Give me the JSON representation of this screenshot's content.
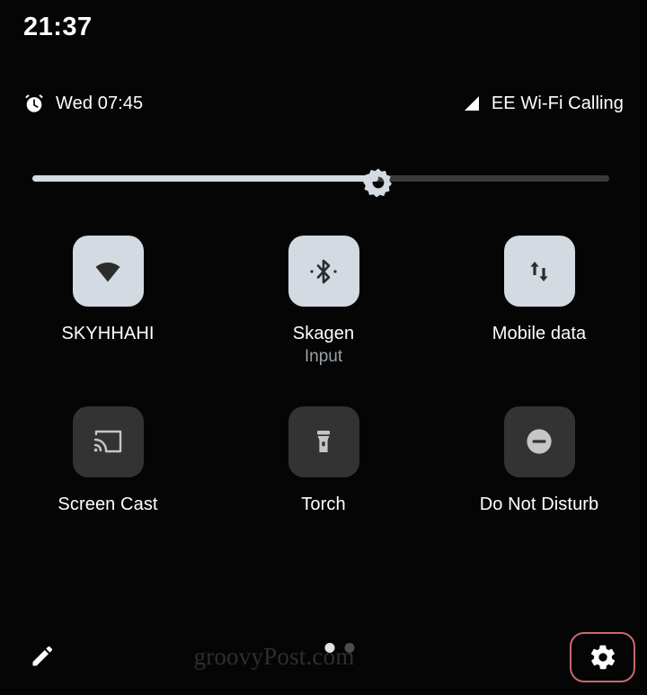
{
  "statusbar": {
    "clock": "21:37",
    "alarm_icon": "alarm-clock-icon",
    "alarm_text": "Wed 07:45",
    "signal_icon": "signal-bars-icon",
    "carrier_text": "EE Wi-Fi Calling"
  },
  "brightness": {
    "name": "brightness-slider",
    "icon": "brightness-sun-icon",
    "value_percent": 60
  },
  "tiles": [
    {
      "id": "wifi",
      "icon": "wifi-icon",
      "label": "SKYHHAHI",
      "sub": "",
      "state": "active"
    },
    {
      "id": "bluetooth",
      "icon": "bluetooth-icon",
      "label": "Skagen",
      "sub": "Input",
      "state": "active"
    },
    {
      "id": "mobile-data",
      "icon": "data-transfer-icon",
      "label": "Mobile data",
      "sub": "",
      "state": "active"
    },
    {
      "id": "screen-cast",
      "icon": "cast-icon",
      "label": "Screen Cast",
      "sub": "",
      "state": "inactive"
    },
    {
      "id": "torch",
      "icon": "flashlight-icon",
      "label": "Torch",
      "sub": "",
      "state": "inactive"
    },
    {
      "id": "do-not-disturb",
      "icon": "do-not-disturb-icon",
      "label": "Do Not Disturb",
      "sub": "",
      "state": "inactive"
    }
  ],
  "footer": {
    "edit_icon": "pencil-edit-icon",
    "watermark": "groovyPost.com",
    "page_dots": [
      true,
      false
    ],
    "settings_icon": "gear-icon",
    "settings_highlight_color": "#c66a6e"
  },
  "colors": {
    "background": "#050505",
    "tile_active_bg": "#d3dae1",
    "tile_inactive_bg": "#333333",
    "tile_active_fg": "#2c2c2c",
    "tile_inactive_fg": "#c6c6c6",
    "text_primary": "#ffffff",
    "text_secondary": "#9aa0a6"
  }
}
